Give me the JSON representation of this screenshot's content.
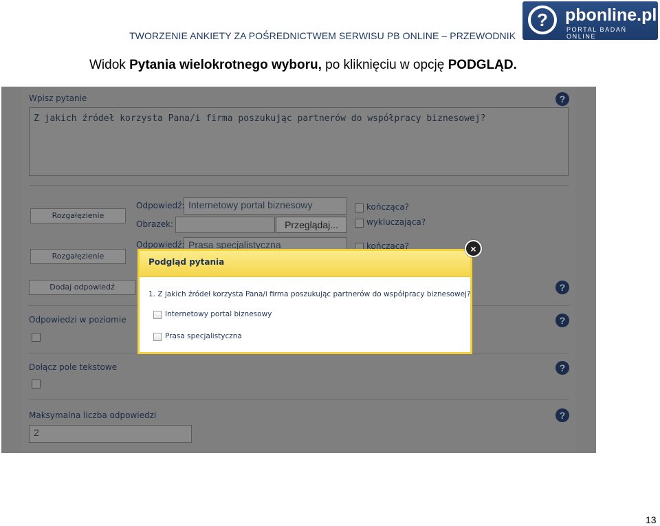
{
  "header": {
    "title": "TWORZENIE ANKIETY ZA POŚREDNICTWEM SERWISU PB ONLINE – PRZEWODNIK",
    "logo_name": "pbonline.pl",
    "logo_tagline": "PORTAL BADAŃ ONLINE",
    "logo_icon": "?"
  },
  "caption": {
    "prefix": "Widok ",
    "bold1": "Pytania wielokrotnego wyboru,",
    "middle": " po kliknięciu w opcję ",
    "bold2": "PODGLĄD."
  },
  "editor": {
    "question_label": "Wpisz pytanie",
    "question_text": "Z jakich źródeł korzysta Pana/i firma poszukując partnerów do współpracy biznesowej?",
    "help_glyph": "?",
    "answers": [
      {
        "branch_button": "Rozgałęzienie",
        "answer_label": "Odpowiedź:",
        "answer_value": "Internetowy portal biznesowy",
        "image_label": "Obrazek:",
        "browse_button": "Przeglądaj...",
        "ending_label": "kończąca?",
        "excluding_label": "wykluczająca?"
      },
      {
        "branch_button": "Rozgałęzienie",
        "answer_label": "Odpowiedź:",
        "answer_value": "Prasa specjalistyczna",
        "ending_label": "kończąca?"
      }
    ],
    "add_answer_button": "Dodaj odpowiedź",
    "horizontal_label": "Odpowiedzi w poziomie",
    "text_field_label": "Dołącz pole tekstowe",
    "max_answers_label": "Maksymalna liczba odpowiedzi",
    "max_answers_value": "2"
  },
  "preview": {
    "title": "Podgląd pytania",
    "question": "1. Z jakich źródeł korzysta Pana/i firma poszukując partnerów do współpracy biznesowej?",
    "options": [
      "Internetowy portal biznesowy",
      "Prasa specjalistyczna"
    ],
    "close_glyph": "×"
  },
  "page_number": "13"
}
